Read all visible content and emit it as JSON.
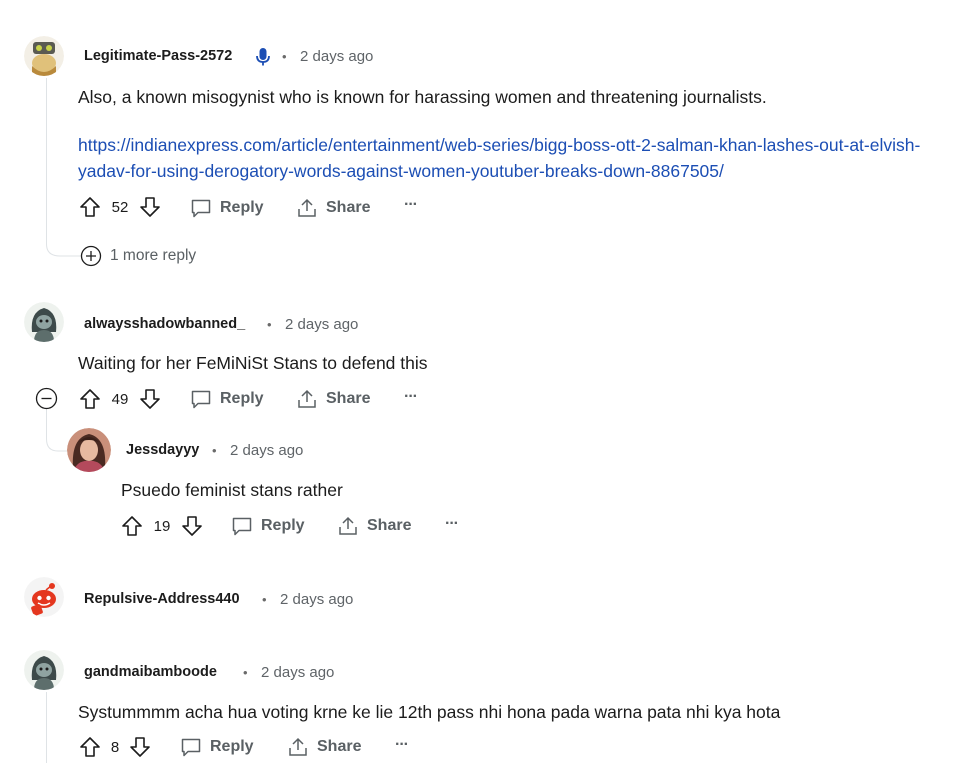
{
  "comments": [
    {
      "username": "Legitimate-Pass-2572",
      "time": "2 days ago",
      "separator": "•",
      "text": "Also, a known misogynist who is known for harassing women and threatening journalists.",
      "link_line1": "https://indianexpress.com/article/entertainment/web-series/bigg-boss-ott-2-salman-khan-lashes-out-at-elvish-",
      "link_line2": "yadav-for-using-derogatory-words-against-women-youtuber-breaks-down-8867505/",
      "votes": "52",
      "more_replies": "1 more reply",
      "avatar_icon": "snoo-goggles-avatar"
    },
    {
      "username": "alwaysshadowbanned_",
      "time": "2 days ago",
      "separator": "•",
      "text": "Waiting for her FeMiNiSt Stans to defend this",
      "votes": "49",
      "avatar_icon": "snoo-hood-avatar"
    },
    {
      "username": "Jessdayyy",
      "time": "2 days ago",
      "separator": "•",
      "text": "Psuedo feminist stans rather",
      "votes": "19",
      "avatar_icon": "photo-avatar"
    },
    {
      "username": "Repulsive-Address440",
      "time": "2 days ago",
      "separator": "•",
      "avatar_icon": "snoo-default-avatar"
    },
    {
      "username": "gandmaibamboode",
      "time": "2 days ago",
      "separator": "•",
      "text": "Systummmm acha hua voting krne ke lie 12th pass nhi hona pada warna pata nhi kya hota",
      "votes": "8",
      "avatar_icon": "snoo-hood-avatar"
    }
  ],
  "actions": {
    "reply": "Reply",
    "share": "Share",
    "overflow": "···"
  },
  "colors": {
    "link": "#1c4eb4",
    "muted": "#5a6064",
    "thread_line": "#dfe3e6",
    "mic_badge": "#1c4eb4"
  }
}
